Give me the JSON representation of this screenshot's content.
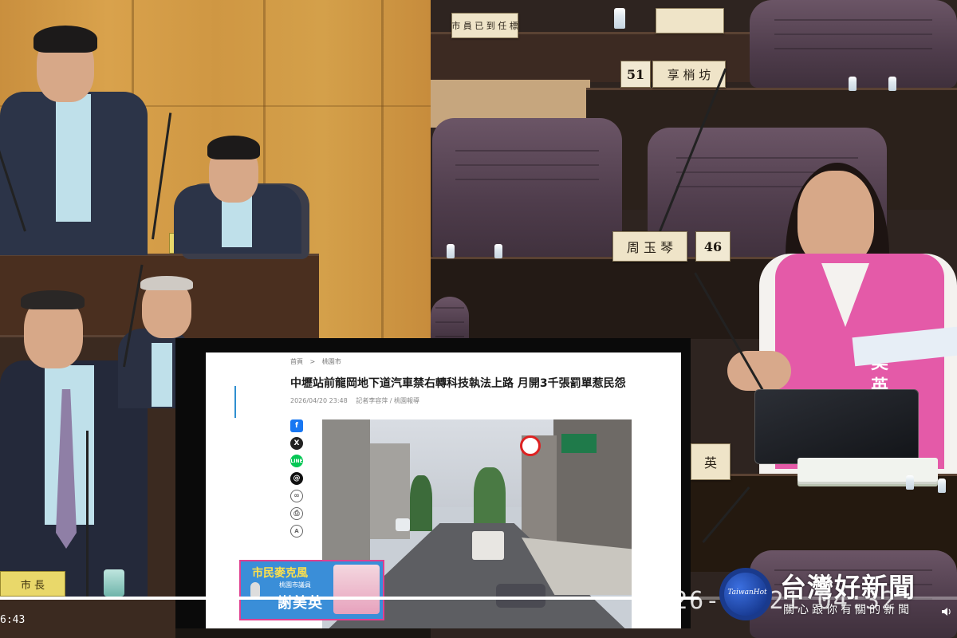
{
  "video": {
    "elapsed_time": "6:43",
    "progress_fraction": 0.73
  },
  "nameplates": {
    "seat_51_number": "51",
    "seat_51_name": "享 梢 坊",
    "seat_46_number": "46",
    "seat_46_name": "周 玉 琴",
    "right_partial": "英",
    "bottom_left_partial": "市    長",
    "top_center": "市 員 已  到 任 標"
  },
  "article": {
    "breadcrumb": [
      "首頁",
      ">",
      "桃園市"
    ],
    "title": "中壢站前龍岡地下道汽車禁右轉科技執法上路 月開3千張罰單惹民怨",
    "date": "2026/04/20 23:48",
    "author": "記者李容萍 / 桃園報導",
    "share_icons": [
      "facebook-icon",
      "x-icon",
      "line-icon",
      "threads-icon",
      "link-icon",
      "print-icon",
      "font-size-icon"
    ]
  },
  "ad": {
    "title": "市民麥克風",
    "subtitle": "桃園市議員",
    "name": "謝美英"
  },
  "vest_text": "美 英",
  "watermark": {
    "timestamp": "2026-04-21 04:32",
    "logo_text": "TaiwanHot",
    "brand": "台灣好新聞",
    "slogan": "關心跟你有關的新聞"
  },
  "colors": {
    "ad_blue": "#3a8ed8",
    "ad_pink": "#e0408f",
    "ad_yellow": "#ffe14a",
    "link_blue": "#2f8fd0",
    "vest_pink": "#e45aa8"
  }
}
